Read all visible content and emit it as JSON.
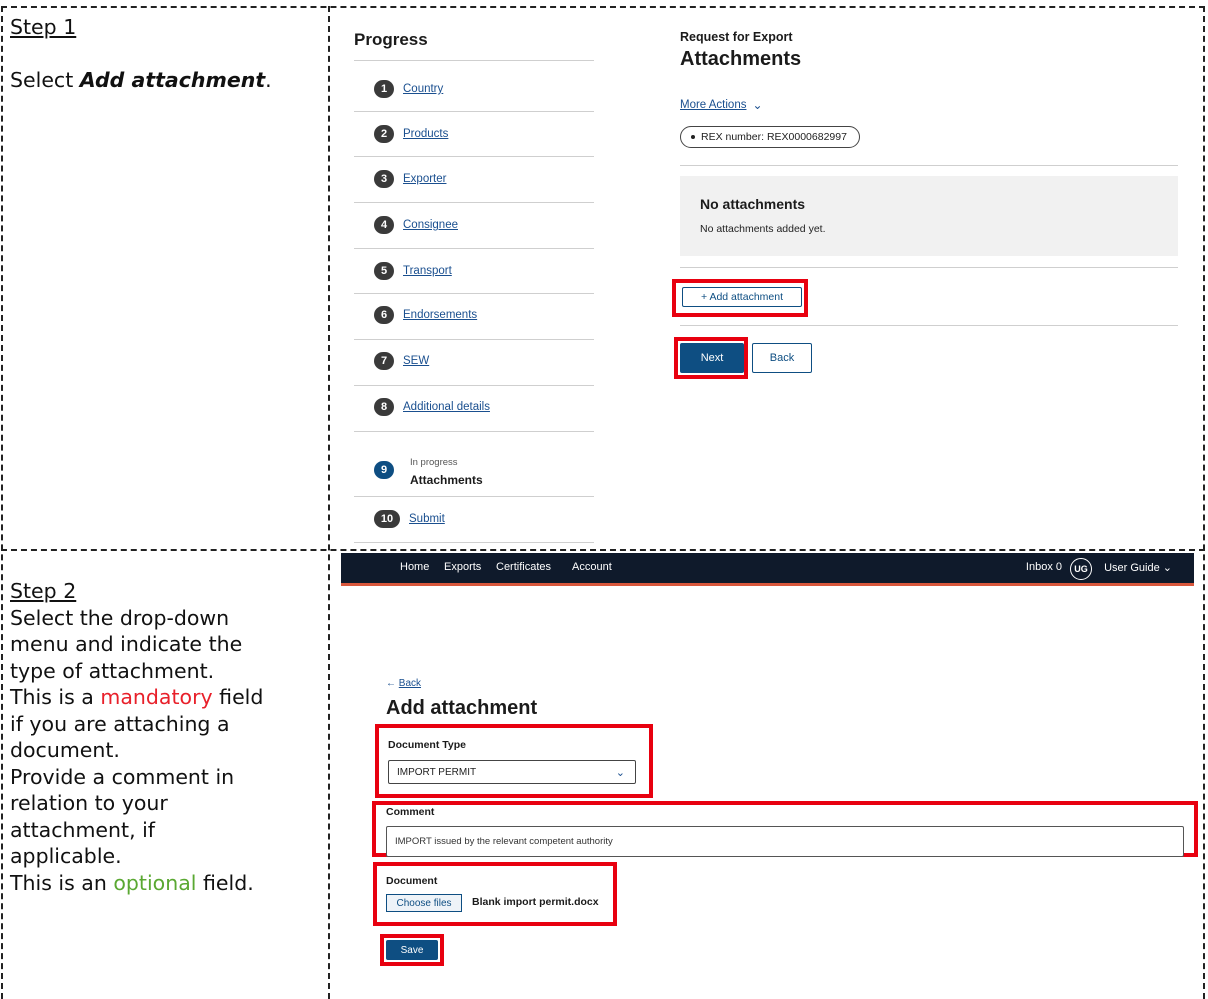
{
  "step1": {
    "title": "Step 1",
    "instruction_prefix": "Select ",
    "instruction_emphasis": "Add attachment",
    "instruction_suffix": ".",
    "progress_title": "Progress",
    "progress_items": [
      {
        "num": "1",
        "label": "Country"
      },
      {
        "num": "2",
        "label": "Products"
      },
      {
        "num": "3",
        "label": "Exporter"
      },
      {
        "num": "4",
        "label": "Consignee"
      },
      {
        "num": "5",
        "label": "Transport"
      },
      {
        "num": "6",
        "label": "Endorsements"
      },
      {
        "num": "7",
        "label": "SEW"
      },
      {
        "num": "8",
        "label": "Additional details"
      }
    ],
    "current_item": {
      "num": "9",
      "status": "In progress",
      "label": "Attachments"
    },
    "last_item": {
      "num": "10",
      "label": "Submit"
    },
    "request_label": "Request for Export",
    "page_title": "Attachments",
    "more_actions": "More Actions",
    "rex_number": "REX number: REX0000682997",
    "empty_title": "No attachments",
    "empty_text": "No attachments added yet.",
    "add_button": "+ Add attachment",
    "next_button": "Next",
    "back_button": "Back"
  },
  "step2": {
    "title": "Step 2",
    "line1": "Select the drop-down",
    "line2": "menu and indicate the",
    "line3": "type of attachment.",
    "line4_prefix": "This is a ",
    "line4_mandatory": "mandatory",
    "line4_suffix": " field",
    "line5": "if you are attaching a",
    "line6": "document.",
    "line7": "Provide a comment in",
    "line8": "relation to your",
    "line9": "attachment, if",
    "line10": "applicable.",
    "line11_prefix": "This is an ",
    "line11_optional": "optional",
    "line11_suffix": " field.",
    "nav": {
      "home": "Home",
      "exports": "Exports",
      "certificates": "Certificates",
      "account": "Account",
      "inbox": "Inbox  0",
      "avatar": "UG",
      "user": "User Guide"
    },
    "back_link": "Back",
    "page_title": "Add attachment",
    "document_type_label": "Document Type",
    "document_type_value": "IMPORT PERMIT",
    "comment_label": "Comment",
    "comment_value": "IMPORT issued by the relevant competent authority",
    "document_label": "Document",
    "choose_button": "Choose files",
    "file_name": "Blank import permit.docx",
    "save_button": "Save"
  },
  "colors": {
    "primary": "#0e4e82",
    "highlight": "#e8000f",
    "mandatory": "#e8202a",
    "optional": "#5aa832",
    "nav_bg": "#0f1a2b",
    "nav_accent": "#d9573c"
  }
}
